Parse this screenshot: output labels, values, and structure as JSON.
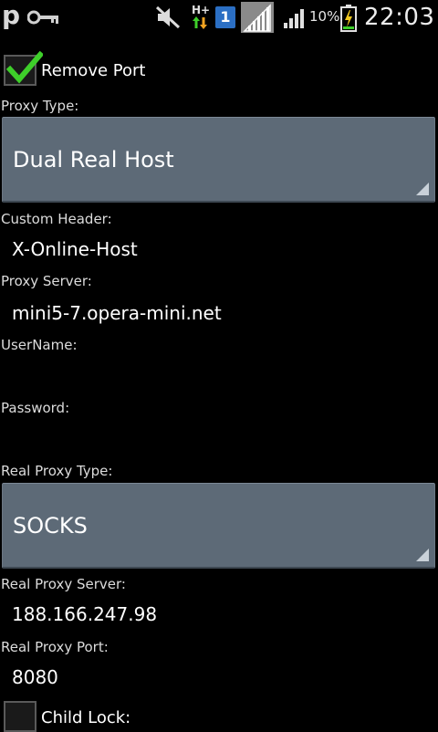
{
  "status_bar": {
    "app_letter": "p",
    "icons": [
      "p-icon",
      "key-icon",
      "mute-icon",
      "h-plus-data-icon",
      "sim-1-icon",
      "signal-icon",
      "signal-2-icon",
      "battery-charging-icon"
    ],
    "network_type": "H+",
    "sim_slot": "1",
    "battery_percent": "10%",
    "time": "22:03"
  },
  "form": {
    "remove_port": {
      "label": "Remove Port",
      "checked": true
    },
    "proxy_type": {
      "label": "Proxy Type:",
      "value": "Dual Real Host"
    },
    "custom_header": {
      "label": "Custom Header:",
      "value": "X-Online-Host"
    },
    "proxy_server": {
      "label": "Proxy Server:",
      "value": "mini5-7.opera-mini.net"
    },
    "username": {
      "label": "UserName:",
      "value": ""
    },
    "password": {
      "label": "Password:",
      "value": ""
    },
    "real_proxy_type": {
      "label": "Real Proxy Type:",
      "value": "SOCKS"
    },
    "real_proxy_server": {
      "label": "Real Proxy Server:",
      "value": "188.166.247.98"
    },
    "real_proxy_port": {
      "label": "Real Proxy Port:",
      "value": "8080"
    },
    "child_lock": {
      "label": "Child Lock:",
      "checked": false
    }
  },
  "colors": {
    "background": "#000000",
    "spinner_bg": "#5d6a77",
    "check_green": "#3ecf2a",
    "sim_blue": "#2b6fc4"
  }
}
